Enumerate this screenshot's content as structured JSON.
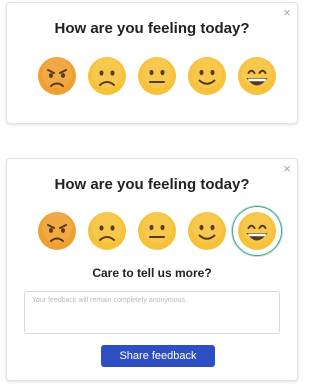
{
  "card_initial": {
    "title": "How are you feeling today?",
    "close_label": "×",
    "emojis": [
      {
        "name": "angry-face-icon",
        "mood": "angry"
      },
      {
        "name": "frowning-face-icon",
        "mood": "frown"
      },
      {
        "name": "neutral-face-icon",
        "mood": "neutral"
      },
      {
        "name": "slightly-smiling-face-icon",
        "mood": "smile"
      },
      {
        "name": "grinning-face-icon",
        "mood": "grin"
      }
    ]
  },
  "card_expanded": {
    "title": "How are you feeling today?",
    "close_label": "×",
    "selected_mood": "grin",
    "followup_title": "Care to tell us more?",
    "feedback_placeholder": "Your feedback will remain completely anonymous.",
    "feedback_value": "",
    "submit_label": "Share feedback"
  },
  "colors": {
    "emoji_yellow": "#f7c23a",
    "emoji_angry": "#f0a030",
    "emoji_features": "#5a3a12",
    "selected_ring": "#3fa693",
    "button_bg": "#2e4fc2",
    "button_text": "#ffffff"
  }
}
